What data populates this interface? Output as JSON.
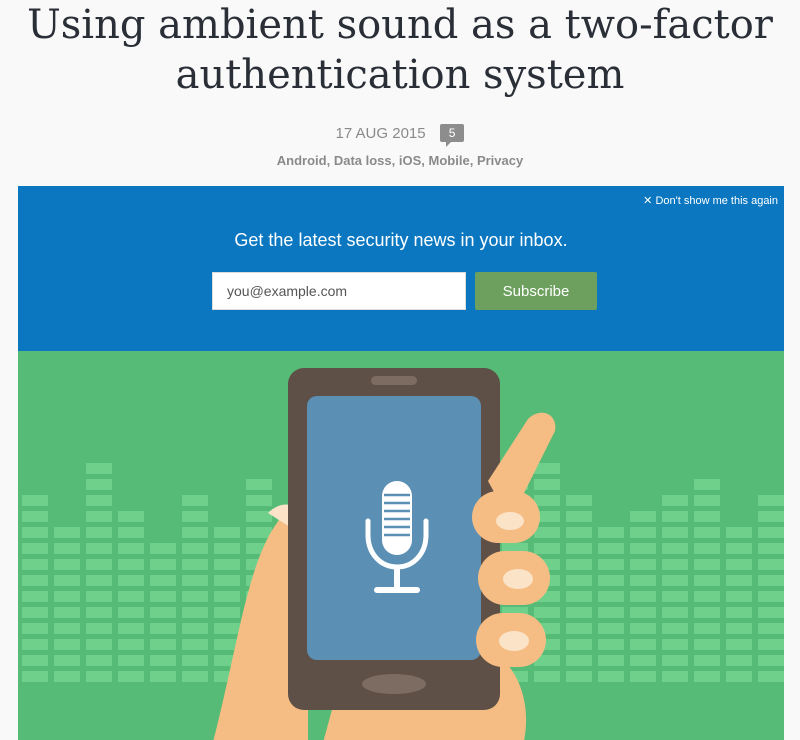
{
  "article": {
    "title_line1": "Using ambient sound as a two-factor",
    "title_line2": "authentication system",
    "date": "17 AUG 2015",
    "comment_count": "5",
    "tags": [
      "Android",
      "Data loss",
      "iOS",
      "Mobile",
      "Privacy"
    ]
  },
  "banner": {
    "dismiss_label": "✕ Don't show me this again",
    "heading": "Get the latest security news in your inbox.",
    "email_placeholder": "you@example.com",
    "subscribe_label": "Subscribe"
  },
  "illustration": {
    "subject": "hand-holding-phone-with-microphone",
    "icon": "microphone-icon"
  },
  "colors": {
    "banner_blue": "#0a77c0",
    "illustration_green": "#56bb76",
    "subscribe_green": "#6da05e",
    "phone_body": "#5f5047",
    "phone_screen": "#5b8fb4",
    "skin": "#f5bd84"
  }
}
